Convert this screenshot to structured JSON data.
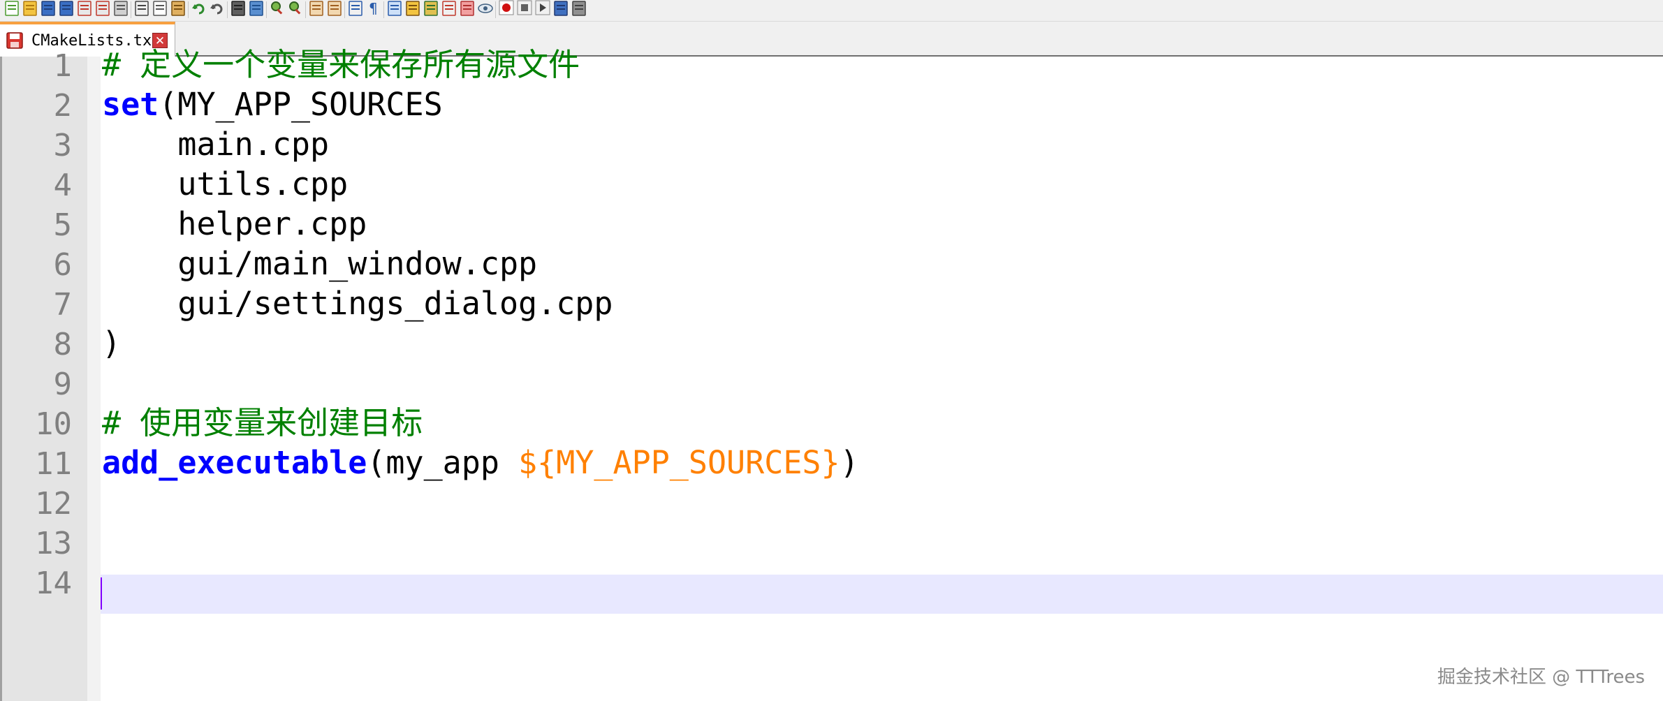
{
  "toolbar": {
    "buttons": [
      {
        "icon": "new-file-icon"
      },
      {
        "icon": "open-file-icon"
      },
      {
        "icon": "save-icon"
      },
      {
        "icon": "save-all-icon"
      },
      {
        "icon": "close-icon"
      },
      {
        "icon": "close-all-icon"
      },
      {
        "icon": "print-icon"
      },
      {
        "icon": "cut-icon"
      },
      {
        "icon": "copy-icon"
      },
      {
        "icon": "paste-icon"
      },
      {
        "icon": "undo-icon"
      },
      {
        "icon": "redo-icon"
      },
      {
        "icon": "find-icon"
      },
      {
        "icon": "replace-icon"
      },
      {
        "icon": "zoom-in-icon"
      },
      {
        "icon": "zoom-out-icon"
      },
      {
        "icon": "sync-vertical-icon"
      },
      {
        "icon": "sync-horizontal-icon"
      },
      {
        "icon": "word-wrap-icon"
      },
      {
        "icon": "show-all-chars-icon"
      },
      {
        "icon": "indent-guide-icon"
      },
      {
        "icon": "define-language-icon"
      },
      {
        "icon": "doc-map-icon"
      },
      {
        "icon": "function-list-icon"
      },
      {
        "icon": "folder-as-workspace-icon"
      },
      {
        "icon": "monitoring-icon"
      },
      {
        "icon": "record-macro-icon"
      },
      {
        "icon": "stop-recording-icon"
      },
      {
        "icon": "playback-macro-icon"
      },
      {
        "icon": "run-macro-multiple-icon"
      },
      {
        "icon": "save-macro-icon"
      }
    ]
  },
  "tabs": [
    {
      "label": "CMakeLists.txt",
      "active": true,
      "close_glyph": "✕"
    }
  ],
  "editor": {
    "lines": [
      {
        "number": "1",
        "tokens": [
          {
            "type": "comment",
            "text": "# 定义一个变量来保存所有源文件"
          }
        ]
      },
      {
        "number": "2",
        "tokens": [
          {
            "type": "keyword",
            "text": "set"
          },
          {
            "type": "plain",
            "text": "(MY_APP_SOURCES"
          }
        ]
      },
      {
        "number": "3",
        "tokens": [
          {
            "type": "plain",
            "text": "    main.cpp"
          }
        ]
      },
      {
        "number": "4",
        "tokens": [
          {
            "type": "plain",
            "text": "    utils.cpp"
          }
        ]
      },
      {
        "number": "5",
        "tokens": [
          {
            "type": "plain",
            "text": "    helper.cpp"
          }
        ]
      },
      {
        "number": "6",
        "tokens": [
          {
            "type": "plain",
            "text": "    gui/main_window.cpp"
          }
        ]
      },
      {
        "number": "7",
        "tokens": [
          {
            "type": "plain",
            "text": "    gui/settings_dialog.cpp"
          }
        ]
      },
      {
        "number": "8",
        "tokens": [
          {
            "type": "plain",
            "text": ")"
          }
        ]
      },
      {
        "number": "9",
        "tokens": []
      },
      {
        "number": "10",
        "tokens": [
          {
            "type": "comment",
            "text": "# 使用变量来创建目标"
          }
        ]
      },
      {
        "number": "11",
        "tokens": [
          {
            "type": "keyword",
            "text": "add_executable"
          },
          {
            "type": "plain",
            "text": "(my_app "
          },
          {
            "type": "var",
            "text": "${MY_APP_SOURCES}"
          },
          {
            "type": "plain",
            "text": ")"
          }
        ]
      },
      {
        "number": "12",
        "tokens": []
      },
      {
        "number": "13",
        "tokens": []
      },
      {
        "number": "14",
        "tokens": []
      }
    ],
    "current_line": "14"
  },
  "colors": {
    "comment": "#008000",
    "keyword": "#0000ff",
    "variable": "#ff8000",
    "line_number": "#808080",
    "current_line_bg": "#e8e8ff",
    "caret": "#8000ff",
    "tab_accent": "#f7a040"
  },
  "watermark": "掘金技术社区 @ TTTrees"
}
